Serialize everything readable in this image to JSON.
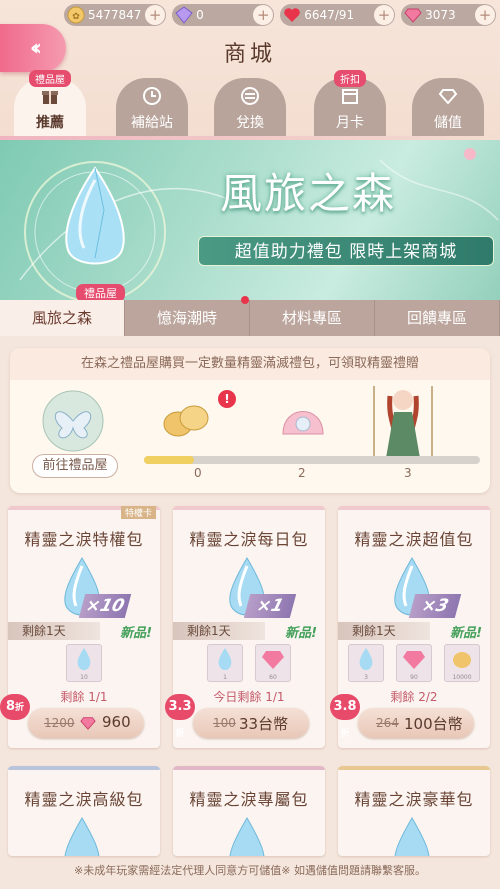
{
  "resources": [
    {
      "name": "gold",
      "value": "5477847"
    },
    {
      "name": "diamond",
      "value": "0"
    },
    {
      "name": "stamina",
      "value": "6647/91"
    },
    {
      "name": "gem",
      "value": "3073"
    }
  ],
  "header": {
    "title": "商城"
  },
  "tabs": [
    {
      "label": "推薦",
      "tag": "禮品屋",
      "active": true
    },
    {
      "label": "補給站",
      "tag": "",
      "active": false
    },
    {
      "label": "兌換",
      "tag": "",
      "active": false
    },
    {
      "label": "月卡",
      "tag": "折扣",
      "active": false
    },
    {
      "label": "儲值",
      "tag": "",
      "active": false
    }
  ],
  "banner": {
    "title": "風旅之森",
    "subtitle": "超值助力禮包  限時上架商城",
    "tag": "禮品屋"
  },
  "subtabs": [
    {
      "label": "風旅之森",
      "active": true
    },
    {
      "label": "憶海潮時",
      "active": false
    },
    {
      "label": "材料專區",
      "active": false
    },
    {
      "label": "回饋專區",
      "active": false
    }
  ],
  "progress_panel": {
    "info": "在森之禮品屋購買一定數量精靈滿滅禮包，可領取精靈禮贈",
    "go_button": "前往禮品屋",
    "milestones": [
      "0",
      "2",
      "3"
    ],
    "progress_fraction": 0.15
  },
  "cards": [
    {
      "name": "精靈之淚特權包",
      "multiplier": "×10",
      "remain_days": "剩餘1天",
      "new_label": "新品!",
      "slots": [
        "10"
      ],
      "limit": "剩餘 1/1",
      "discount": "8",
      "discount_unit": "折",
      "old_price": "1200",
      "price": "960",
      "currency": "gem",
      "priv_tag": "特權卡"
    },
    {
      "name": "精靈之淚每日包",
      "multiplier": "×1",
      "remain_days": "剩餘1天",
      "new_label": "新品!",
      "slots": [
        "1",
        "60"
      ],
      "limit": "今日剩餘 1/1",
      "discount": "3.3",
      "discount_unit": "折",
      "old_price": "100",
      "price": "33台幣",
      "currency": "twd",
      "priv_tag": ""
    },
    {
      "name": "精靈之淚超值包",
      "multiplier": "×3",
      "remain_days": "剩餘1天",
      "new_label": "新品!",
      "slots": [
        "3",
        "90",
        "10000"
      ],
      "limit": "剩餘 2/2",
      "discount": "3.8",
      "discount_unit": "折",
      "old_price": "264",
      "price": "100台幣",
      "currency": "twd",
      "priv_tag": ""
    },
    {
      "name": "精靈之淚高級包"
    },
    {
      "name": "精靈之淚專屬包"
    },
    {
      "name": "精靈之淚豪華包"
    }
  ],
  "footer": {
    "note": "※未成年玩家需經法定代理人同意方可儲值※ 如遇儲值問題請聯繫客服。"
  },
  "colors": {
    "accent": "#e64c6e",
    "new": "#44a05a",
    "background": "#f4e6dc"
  }
}
